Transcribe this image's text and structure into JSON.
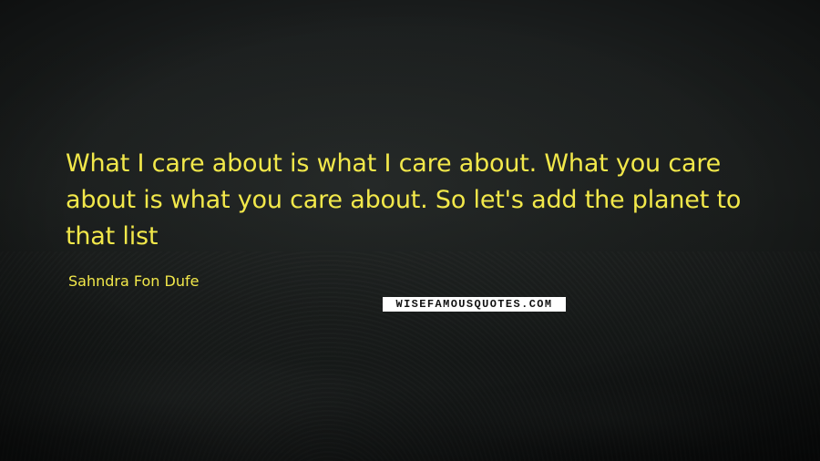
{
  "quote": {
    "text": "What I care about is what I care about. What you care about is what you care about. So let's add the planet to that list",
    "author": "Sahndra Fon Dufe"
  },
  "watermark": {
    "text": "WISEFAMOUSQUOTES.COM"
  },
  "colors": {
    "quote_text": "#f2e84a",
    "background": "#1a1d1c"
  }
}
